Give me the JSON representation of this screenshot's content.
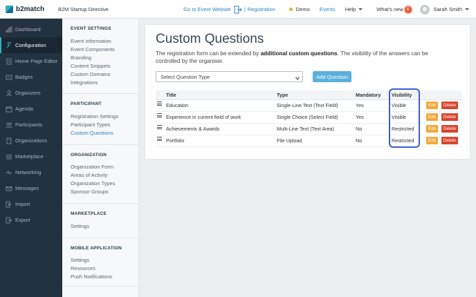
{
  "header": {
    "brand": "b2match",
    "event_name": "B2M Startup Directive",
    "go_to_event": "Go to Event Website",
    "separator": "|",
    "registration": "Registration",
    "demo": "Demo",
    "events": "Events",
    "help": "Help",
    "whats_new": "What's new",
    "whats_new_count": "6",
    "user_name": "Sarah Smith"
  },
  "sidebar": {
    "items": [
      {
        "label": "Dashboard",
        "icon": "dashboard-icon"
      },
      {
        "label": "Configuration",
        "icon": "wrench-icon"
      },
      {
        "label": "Home Page Editor",
        "icon": "document-icon"
      },
      {
        "label": "Badges",
        "icon": "badge-icon"
      },
      {
        "label": "Organizers",
        "icon": "users-icon"
      },
      {
        "label": "Agenda",
        "icon": "calendar-icon"
      },
      {
        "label": "Participants",
        "icon": "participants-icon"
      },
      {
        "label": "Organizations",
        "icon": "building-icon"
      },
      {
        "label": "Marketplace",
        "icon": "list-icon"
      },
      {
        "label": "Networking",
        "icon": "network-icon"
      },
      {
        "label": "Messages",
        "icon": "envelope-icon"
      },
      {
        "label": "Import",
        "icon": "import-icon"
      },
      {
        "label": "Export",
        "icon": "export-icon"
      }
    ],
    "active_index": 1
  },
  "submenu": {
    "event_settings": {
      "heading": "EVENT SETTINGS",
      "items": [
        "Event Information",
        "Event Components",
        "Branding",
        "Content Snippets",
        "Custom Domains",
        "Integrations"
      ]
    },
    "participant": {
      "heading": "PARTICIPANT",
      "items": [
        "Registration Settings",
        "Participant Types",
        "Custom Questions"
      ]
    },
    "organization": {
      "heading": "ORGANIZATION",
      "items": [
        "Organization Form",
        "Areas of Activity",
        "Organization Types",
        "Sponsor Groups"
      ]
    },
    "marketplace": {
      "heading": "MARKETPLACE",
      "items": [
        "Settings"
      ]
    },
    "mobile": {
      "heading": "MOBILE APPLICATION",
      "items": [
        "Settings",
        "Resources",
        "Push Notifications"
      ]
    }
  },
  "main": {
    "title": "Custom Questions",
    "desc_part1": "The registration form can be extended by ",
    "desc_bold": "additional custom questions",
    "desc_part2": ". The visibility of the answers can be controlled by the organiser.",
    "select_placeholder": "Select Question Type",
    "add_button": "Add Question",
    "columns": {
      "title": "Title",
      "type": "Type",
      "mandatory": "Mandatory",
      "visibility": "Visibility"
    },
    "rows": [
      {
        "title": "Education",
        "type": "Single-Line Text (Text Field)",
        "mandatory": "Yes",
        "visibility": "Visible"
      },
      {
        "title": "Experience in current field of work",
        "type": "Single Choice (Select Field)",
        "mandatory": "Yes",
        "visibility": "Visible"
      },
      {
        "title": "Achievements & Awards",
        "type": "Multi-Line Text (Text Area)",
        "mandatory": "No",
        "visibility": "Restricted"
      },
      {
        "title": "Portfolio",
        "type": "File Upload",
        "mandatory": "No",
        "visibility": "Restricted"
      }
    ],
    "edit_label": "Edit",
    "delete_label": "Delete"
  },
  "colors": {
    "sidebar_bg": "#233240",
    "accent": "#2f80c3",
    "edit": "#f0a93a",
    "delete": "#d8452f",
    "highlight": "#3b59d4"
  }
}
